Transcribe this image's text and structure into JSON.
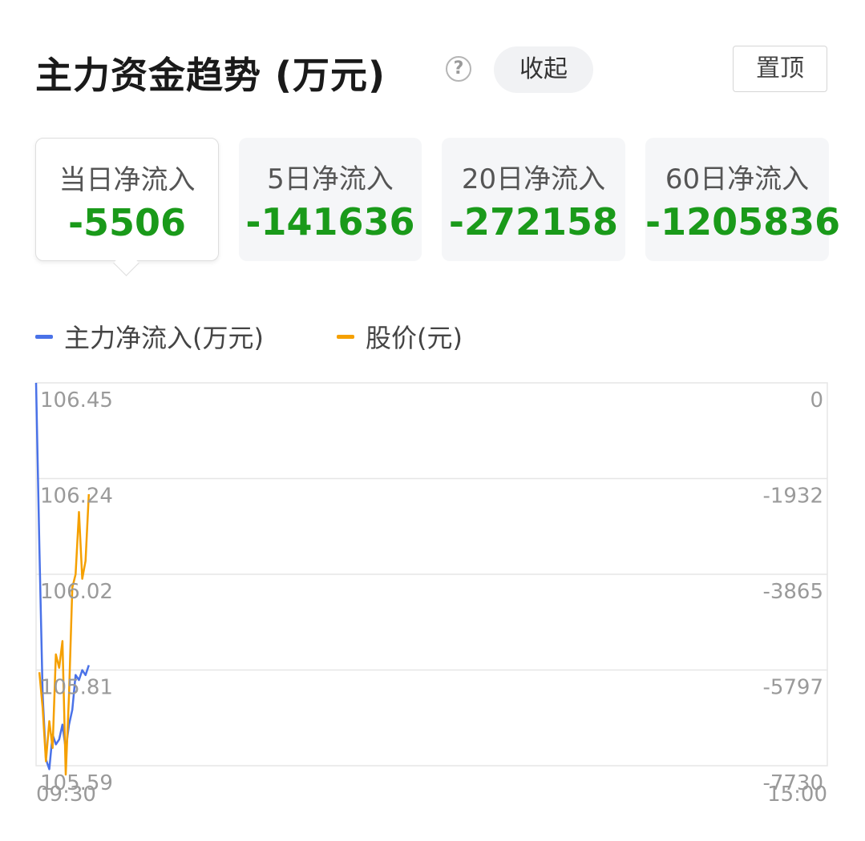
{
  "header": {
    "title": "主力资金趋势 (万元)",
    "help_icon": "?",
    "collapse_label": "收起",
    "pin_label": "置顶"
  },
  "cards": [
    {
      "label": "当日净流入",
      "value": "-5506"
    },
    {
      "label": "5日净流入",
      "value": "-141636"
    },
    {
      "label": "20日净流入",
      "value": "-272158"
    },
    {
      "label": "60日净流入",
      "value": "-1205836"
    }
  ],
  "colors": {
    "flow_line": "#4a72e8",
    "price_line": "#f5a000",
    "negative": "#1a9a1a"
  },
  "chart_data": {
    "type": "line",
    "legend": [
      {
        "name": "主力净流入(万元)",
        "color": "#4a72e8"
      },
      {
        "name": "股价(元)",
        "color": "#f5a000"
      }
    ],
    "left_axis_labels": [
      "106.45",
      "106.24",
      "106.02",
      "105.81",
      "105.59"
    ],
    "right_axis_labels": [
      "0",
      "-1932",
      "-3865",
      "-5797",
      "-7730"
    ],
    "x_labels": [
      "09:30",
      "15:00"
    ],
    "left_ylim": [
      105.59,
      106.45
    ],
    "right_ylim": [
      -7730,
      0
    ],
    "x_range_minutes": [
      0,
      240
    ],
    "grid": true,
    "series": [
      {
        "name": "主力净流入(万元)",
        "axis": "right",
        "x": [
          0,
          1,
          2,
          3,
          4,
          5,
          6,
          7,
          8,
          9,
          10,
          11,
          12,
          13,
          14,
          15,
          16
        ],
        "y": [
          0,
          -3300,
          -6300,
          -7600,
          -7800,
          -7100,
          -7300,
          -7200,
          -6900,
          -7400,
          -6900,
          -6600,
          -5900,
          -6000,
          -5800,
          -5900,
          -5700
        ]
      },
      {
        "name": "股价(元)",
        "axis": "left",
        "x": [
          1,
          2,
          3,
          4,
          5,
          6,
          7,
          8,
          9,
          10,
          11,
          12,
          13,
          14,
          15,
          16
        ],
        "y": [
          105.8,
          105.72,
          105.6,
          105.69,
          105.63,
          105.84,
          105.81,
          105.87,
          105.57,
          105.75,
          105.99,
          106.02,
          106.16,
          106.01,
          106.05,
          106.2
        ]
      }
    ]
  }
}
